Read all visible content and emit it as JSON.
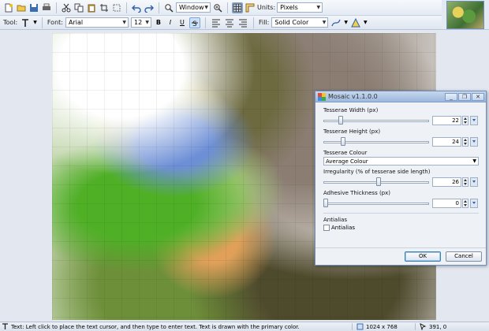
{
  "toolbar": {
    "zoom_select": "Window",
    "units_label": "Units:",
    "units_select": "Pixels"
  },
  "format_bar": {
    "tool_label": "Tool:",
    "font_label": "Font:",
    "font_name": "Arial",
    "font_size": "12",
    "bold": "B",
    "italic": "I",
    "underline": "U",
    "fill_label": "Fill:",
    "fill_mode": "Solid Color"
  },
  "dialog": {
    "title": "Mosaic v1.1.0.0",
    "tesserae_width": {
      "label": "Tesserae Width (px)",
      "value": "22",
      "fraction": 0.15
    },
    "tesserae_height": {
      "label": "Tesserae Height (px)",
      "value": "24",
      "fraction": 0.17
    },
    "tesserae_colour": {
      "label": "Tesserae Colour",
      "value": "Average Colour"
    },
    "irregularity": {
      "label": "Irregularity (% of tesserae side length)",
      "value": "26",
      "fraction": 0.52
    },
    "adhesive": {
      "label": "Adhesive Thickness (px)",
      "value": "0",
      "fraction": 0.0
    },
    "antialias_group": "Antialias",
    "antialias_checkbox": "Antialias",
    "ok": "OK",
    "cancel": "Cancel"
  },
  "status": {
    "message": "Text: Left click to place the text cursor, and then type to enter text. Text is drawn with the primary color.",
    "image_size": "1024 x 768",
    "cursor_pos": "391, 0"
  }
}
